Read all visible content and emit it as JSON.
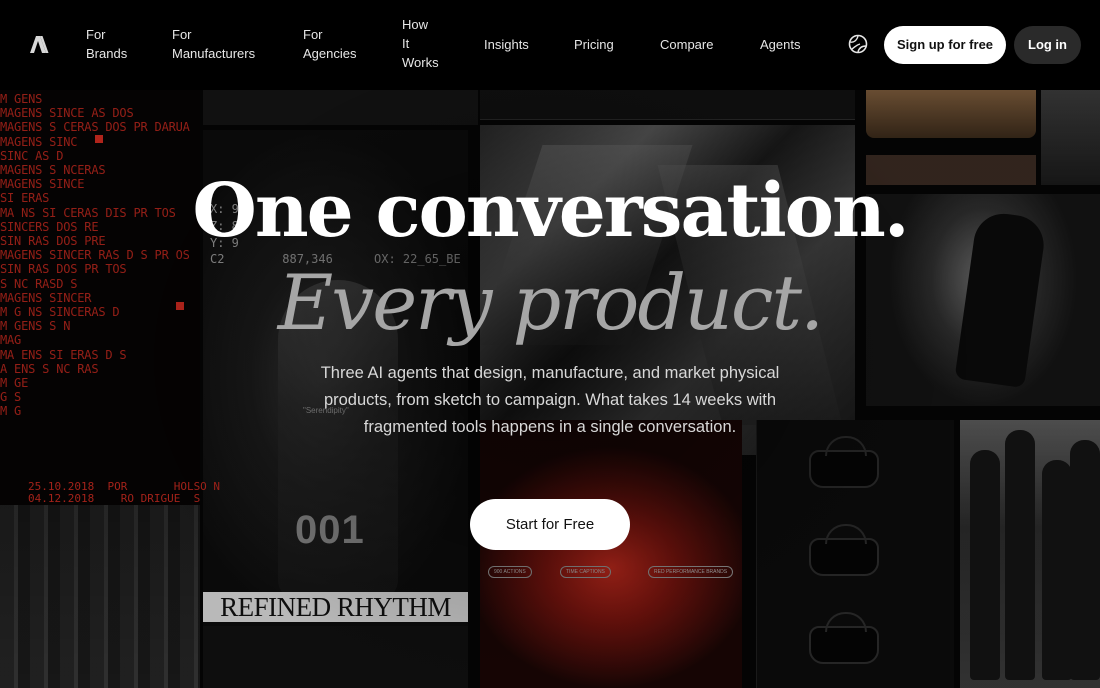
{
  "nav": {
    "logo_icon": "brand-logo-icon",
    "items": [
      {
        "label_lines": [
          "For",
          "Brands"
        ]
      },
      {
        "label_lines": [
          "For",
          "Manufacturers"
        ]
      },
      {
        "label_lines": [
          "For",
          "Agencies"
        ]
      },
      {
        "label_lines": [
          "How",
          "It",
          "Works"
        ]
      },
      {
        "label_lines": [
          "Insights"
        ]
      },
      {
        "label_lines": [
          "Pricing"
        ]
      },
      {
        "label_lines": [
          "Compare"
        ]
      },
      {
        "label_lines": [
          "Agents"
        ]
      }
    ],
    "globe_icon": "globe-icon",
    "signup_label": "Sign up for free",
    "login_label": "Log in"
  },
  "hero": {
    "line1": "One conversation.",
    "line2": "Every product.",
    "subtitle": "Three AI agents that design, manufacture, and market physical products, from sketch to campaign. What takes 14 weeks with fragmented tools happens in a single conversation.",
    "cta_label": "Start for Free"
  },
  "collage": {
    "code_lines": [
      "M  GENS",
      "MAGENS SINCE  AS DOS",
      "MAGENS S  CERAS DOS PR DARUA",
      "MAGENS SINC",
      "       SINC   AS D",
      "MAGENS S NCERAS",
      "MAGENS SINCE",
      "       SI  ERAS",
      "MA   NS  SI  CERAS DIS PR  TOS",
      "       SINCERS  DOS  RE",
      "       SIN   RAS DOS PRE",
      "MAGENS SINCER  RAS D  S PR   OS",
      "       SIN   RAS DOS PR  TOS",
      "       S NC RASD  S",
      "MAGENS SINCER",
      "M  G  NS  SINCERAS D",
      "M  GENS  S  N",
      "MAG",
      "MA  ENS SI  ERAS   D S",
      "  A  ENS  S  NC  RAS",
      "M  GE",
      "  G    S",
      "M  G"
    ],
    "coord_lines": [
      "X: 9",
      "Z: 8",
      "Y: 9",
      "C2        887,346",
      "OX: 22_65_BE"
    ],
    "date_lines": [
      "25.10.2018  POR       HOLSO N",
      "04.12.2018    RO DRIGUE  S"
    ],
    "caption": "\"Serendipity\"",
    "number": "001",
    "rhythm_text": "REFINED RHYTHM",
    "pills": [
      "900 ACTIONS",
      "TIME CAPTIONS",
      "RED PERFORMANCE BRANDS"
    ]
  }
}
